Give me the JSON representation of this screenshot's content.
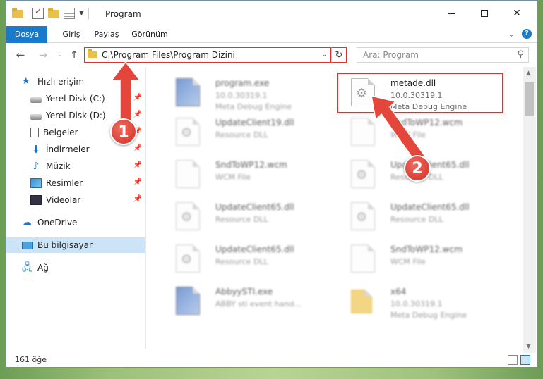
{
  "window": {
    "title": "Program",
    "controls": {
      "minimize": "",
      "maximize": "",
      "close": "✕"
    }
  },
  "ribbon": {
    "tabs": [
      {
        "label": "Dosya",
        "active": true
      },
      {
        "label": "Giriş",
        "active": false
      },
      {
        "label": "Paylaş",
        "active": false
      },
      {
        "label": "Görünüm",
        "active": false
      }
    ],
    "help_label": "?"
  },
  "navigation": {
    "address_path": "C:\\Program Files\\Program Dizini",
    "search_placeholder": "Ara: Program"
  },
  "sidebar": {
    "items": [
      {
        "label": "Hızlı erişim",
        "icon": "star-icon",
        "pinned": false
      },
      {
        "label": "Yerel Disk (C:)",
        "icon": "drive-icon",
        "pinned": true
      },
      {
        "label": "Yerel Disk (D:)",
        "icon": "drive-icon",
        "pinned": true
      },
      {
        "label": "Belgeler",
        "icon": "document-icon",
        "pinned": true
      },
      {
        "label": "İndirmeler",
        "icon": "download-icon",
        "pinned": true
      },
      {
        "label": "Müzik",
        "icon": "music-icon",
        "pinned": true
      },
      {
        "label": "Resimler",
        "icon": "pictures-icon",
        "pinned": true
      },
      {
        "label": "Videolar",
        "icon": "video-icon",
        "pinned": true
      },
      {
        "label": "OneDrive",
        "icon": "cloud-icon",
        "pinned": false
      },
      {
        "label": "Bu bilgisayar",
        "icon": "computer-icon",
        "pinned": false,
        "selected": true
      },
      {
        "label": "Ağ",
        "icon": "network-icon",
        "pinned": false
      }
    ]
  },
  "files": [
    {
      "name": "program.exe",
      "line1": "10.0.30319.1",
      "line2": "Meta Debug Engine",
      "icon": "exe-icon"
    },
    {
      "name": "metade.dll",
      "line1": "10.0.30319.1",
      "line2": "Meta Debug Engine",
      "icon": "dll-icon",
      "highlighted": true
    },
    {
      "name": "UpdateClient19.dll",
      "line1": "Resource DLL",
      "line2": "",
      "icon": "dll-icon"
    },
    {
      "name": "SndToWP12.wcm",
      "line1": "WCM File",
      "line2": "",
      "icon": "file-icon"
    },
    {
      "name": "SndToWP12.wcm",
      "line1": "WCM File",
      "line2": "",
      "icon": "file-icon"
    },
    {
      "name": "UpdateClient65.dll",
      "line1": "Resource DLL",
      "line2": "",
      "icon": "dll-icon"
    },
    {
      "name": "UpdateClient65.dll",
      "line1": "Resource DLL",
      "line2": "",
      "icon": "dll-icon"
    },
    {
      "name": "UpdateClient65.dll",
      "line1": "Resource DLL",
      "line2": "",
      "icon": "dll-icon"
    },
    {
      "name": "UpdateClient65.dll",
      "line1": "Resource DLL",
      "line2": "",
      "icon": "dll-icon"
    },
    {
      "name": "SndToWP12.wcm",
      "line1": "WCM File",
      "line2": "",
      "icon": "file-icon"
    },
    {
      "name": "AbbyySTI.exe",
      "line1": "ABBY sti event hand...",
      "line2": "",
      "icon": "exe-icon"
    },
    {
      "name": "x64",
      "line1": "10.0.30319.1",
      "line2": "Meta Debug Engine",
      "icon": "folder-icon"
    }
  ],
  "status": {
    "item_count": "161 öğe"
  },
  "annotations": {
    "badge1": "1",
    "badge2": "2"
  },
  "colors": {
    "accent": "#1979ca",
    "annotation": "#d9332f"
  }
}
